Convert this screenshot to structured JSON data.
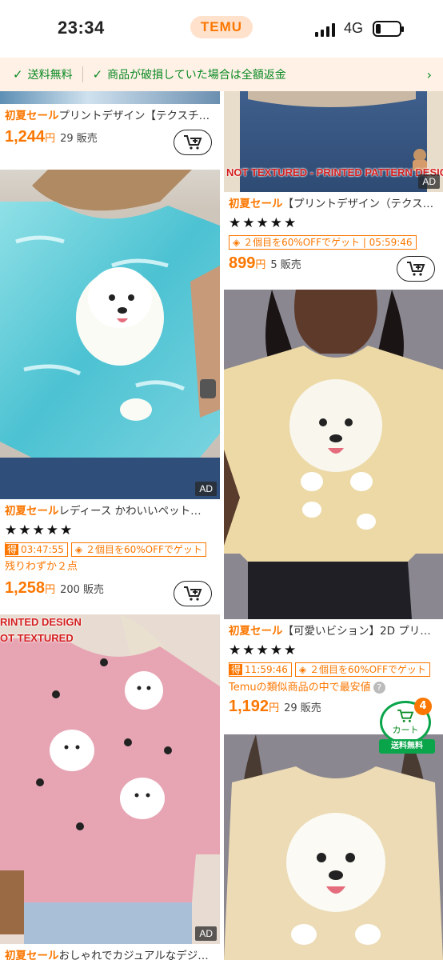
{
  "status_bar": {
    "time": "23:34",
    "network": "4G"
  },
  "app": {
    "logo": "TEMU"
  },
  "banner": {
    "item1": "送料無料",
    "item2": "商品が破損していた場合は全額返金"
  },
  "products": {
    "p1": {
      "sale": "初夏セール",
      "title": "プリントデザイン【テクスチ…",
      "price": "1,244",
      "yen": "円",
      "sold": "29 販売"
    },
    "p2": {
      "overlay": "NOT TEXTURED - PRINTED PATTERN DESIGN",
      "ad": "AD",
      "sale": "初夏セール",
      "title": "【プリントデザイン（テクスチ…",
      "stars": "★★★★★",
      "deal": "２個目を60%OFFでゲット",
      "countdown": "05:59:46",
      "price": "899",
      "yen": "円",
      "sold": "5 販売"
    },
    "p3": {
      "ad": "AD",
      "sale": "初夏セール",
      "title": "レディース かわいいペット…",
      "stars": "★★★★★",
      "timer_label": "得",
      "countdown": "03:47:55",
      "deal": "２個目を60%OFFでゲット",
      "scarce": "残りわずか２点",
      "price": "1,258",
      "yen": "円",
      "sold": "200 販売"
    },
    "p4": {
      "sale": "初夏セール",
      "title": "【可愛いビション】2D プリン…",
      "stars": "★★★★★",
      "timer_label": "得",
      "countdown": "11:59:46",
      "deal": "２個目を60%OFFでゲット",
      "cheapest": "Temuの類似商品の中で最安値",
      "price": "1,192",
      "yen": "円",
      "sold": "29 販売"
    },
    "p5": {
      "overlay1": "RINTED DESIGN",
      "overlay2": "OT TEXTURED",
      "ad": "AD",
      "sale": "初夏セール",
      "title": "おしゃれでカジュアルなデジ…"
    }
  },
  "floating_cart": {
    "count": "4",
    "label": "カート",
    "free": "送料無料"
  },
  "colors": {
    "accent": "#fb7701",
    "green": "#0aa54a"
  }
}
